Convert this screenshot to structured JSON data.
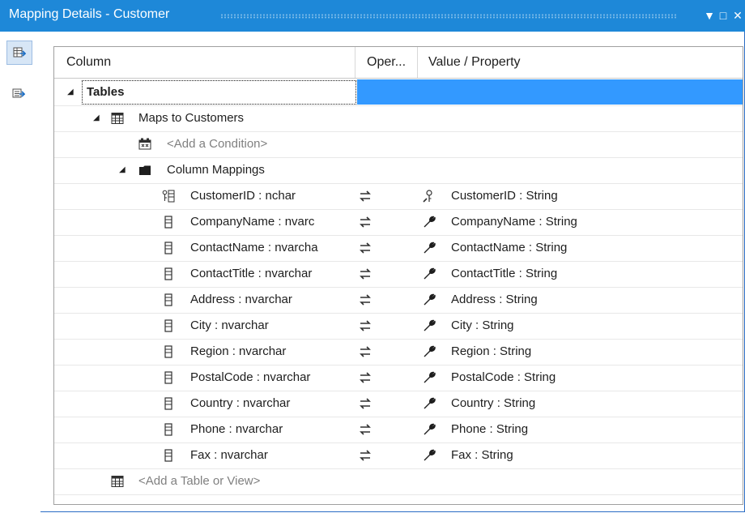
{
  "window": {
    "title": "Mapping Details - Customer",
    "menu_glyph": "▼",
    "max_glyph": "□",
    "close_glyph": "✕"
  },
  "sidebar": {
    "items": [
      {
        "icon": "mapping-view-icon"
      },
      {
        "icon": "switch-view-icon"
      }
    ]
  },
  "columns": {
    "column": "Column",
    "operator": "Oper...",
    "value": "Value / Property"
  },
  "tree": {
    "tables_label": "Tables",
    "maps_to": "Maps to Customers",
    "add_condition": "<Add a Condition>",
    "column_mappings": "Column Mappings",
    "add_table": "<Add a Table or View>",
    "mappings": [
      {
        "column": "CustomerID : nchar",
        "operator": "⇄",
        "property": "CustomerID : String",
        "key": true
      },
      {
        "column": "CompanyName : nvarc",
        "operator": "⇄",
        "property": "CompanyName : String",
        "key": false
      },
      {
        "column": "ContactName : nvarcha",
        "operator": "⇄",
        "property": "ContactName : String",
        "key": false
      },
      {
        "column": "ContactTitle : nvarchar",
        "operator": "⇄",
        "property": "ContactTitle : String",
        "key": false
      },
      {
        "column": "Address : nvarchar",
        "operator": "⇄",
        "property": "Address : String",
        "key": false
      },
      {
        "column": "City : nvarchar",
        "operator": "⇄",
        "property": "City : String",
        "key": false
      },
      {
        "column": "Region : nvarchar",
        "operator": "⇄",
        "property": "Region : String",
        "key": false
      },
      {
        "column": "PostalCode : nvarchar",
        "operator": "⇄",
        "property": "PostalCode : String",
        "key": false
      },
      {
        "column": "Country : nvarchar",
        "operator": "⇄",
        "property": "Country : String",
        "key": false
      },
      {
        "column": "Phone : nvarchar",
        "operator": "⇄",
        "property": "Phone : String",
        "key": false
      },
      {
        "column": "Fax : nvarchar",
        "operator": "⇄",
        "property": "Fax : String",
        "key": false
      }
    ]
  },
  "colors": {
    "titlebar": "#1e88d8",
    "selection": "#3399ff"
  }
}
